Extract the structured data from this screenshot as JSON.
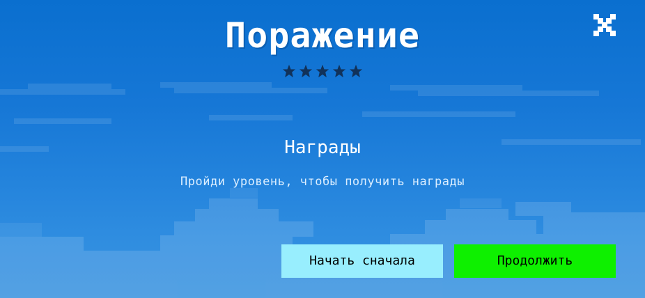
{
  "screen": {
    "title": "Поражение",
    "stars": {
      "earned": 0,
      "total": 5,
      "icon": "star-icon",
      "empty_color": "#11325a"
    },
    "close_icon": "close-icon"
  },
  "rewards": {
    "title": "Награды",
    "hint": "Пройди уровень, чтобы получить награды"
  },
  "buttons": {
    "restart_label": "Начать сначала",
    "continue_label": "Продолжить"
  },
  "colors": {
    "sky_top": "#0a6fcf",
    "sky_bottom": "#3a93df",
    "restart_bg": "#98eefe",
    "continue_bg": "#0ef000"
  }
}
